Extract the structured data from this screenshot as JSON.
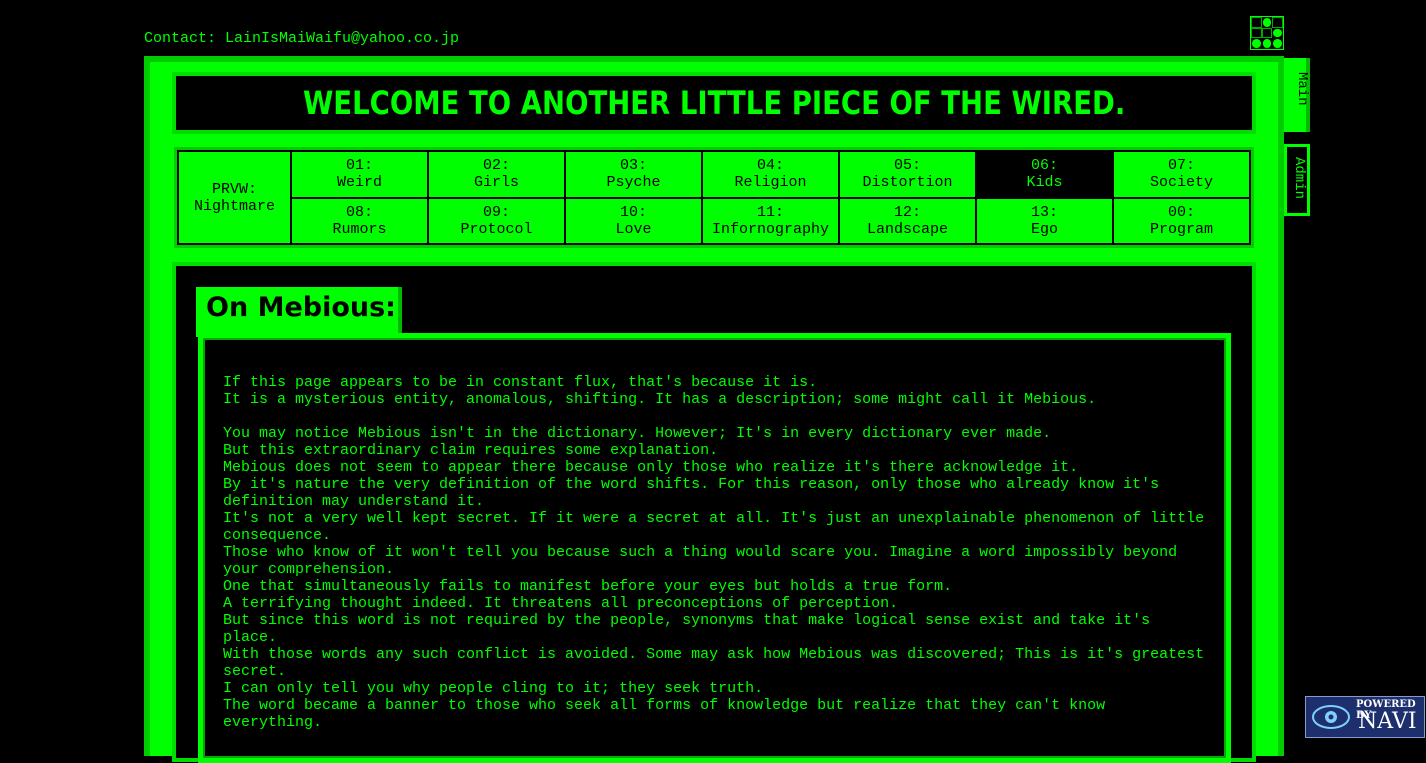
{
  "contact": "Contact: LainIsMaiWaifu@yahoo.co.jp",
  "banner": {
    "title": "WELCOME TO ANOTHER LITTLE PIECE OF THE WIRED."
  },
  "nav": {
    "prvw": {
      "line1": "PRVW:",
      "line2": "Nightmare"
    },
    "row1": [
      {
        "num": "01:",
        "label": "Weird"
      },
      {
        "num": "02:",
        "label": "Girls"
      },
      {
        "num": "03:",
        "label": "Psyche"
      },
      {
        "num": "04:",
        "label": "Religion"
      },
      {
        "num": "05:",
        "label": "Distortion"
      },
      {
        "num": "06:",
        "label": "Kids"
      },
      {
        "num": "07:",
        "label": "Society"
      }
    ],
    "row2": [
      {
        "num": "08:",
        "label": "Rumors"
      },
      {
        "num": "09:",
        "label": "Protocol"
      },
      {
        "num": "10:",
        "label": "Love"
      },
      {
        "num": "11:",
        "label": "Infornography"
      },
      {
        "num": "12:",
        "label": "Landscape"
      },
      {
        "num": "13:",
        "label": "Ego"
      },
      {
        "num": "00:",
        "label": "Program"
      }
    ]
  },
  "side_tabs": {
    "main": "Main",
    "admin": "Admin"
  },
  "article": {
    "heading": "On Mebious:",
    "lines": [
      "If this page appears to be in constant flux, that's because it is.",
      "It is a mysterious entity, anomalous, shifting. It has a description; some might call it Mebious.",
      "",
      "You may notice Mebious isn't in the dictionary. However; It's in every dictionary ever made.",
      "But this extraordinary claim requires some explanation.",
      "Mebious does not seem to appear there because only those who realize it's there acknowledge it.",
      "By it's nature the very definition of the word shifts. For this reason, only those who already know it's definition may understand it.",
      "It's not a very well kept secret. If it were a secret at all. It's just an unexplainable phenomenon of little consequence.",
      "Those who know of it won't tell you because such a thing would scare you. Imagine a word impossibly beyond your comprehension.",
      "One that simultaneously fails to manifest before your eyes but holds a true form.",
      "A terrifying thought indeed. It threatens all preconceptions of perception.",
      "But since this word is not required by the people, synonyms that make logical sense exist and take it's place.",
      "With those words any such conflict is avoided. Some may ask how Mebious was discovered; This is it's greatest secret.",
      "I can only tell you why people cling to it; they seek truth.",
      "The word became a banner to those who seek all forms of knowledge but realize that they can't know everything."
    ]
  },
  "navi_badge": {
    "powered": "POWERED BY",
    "name": "NAVI"
  }
}
